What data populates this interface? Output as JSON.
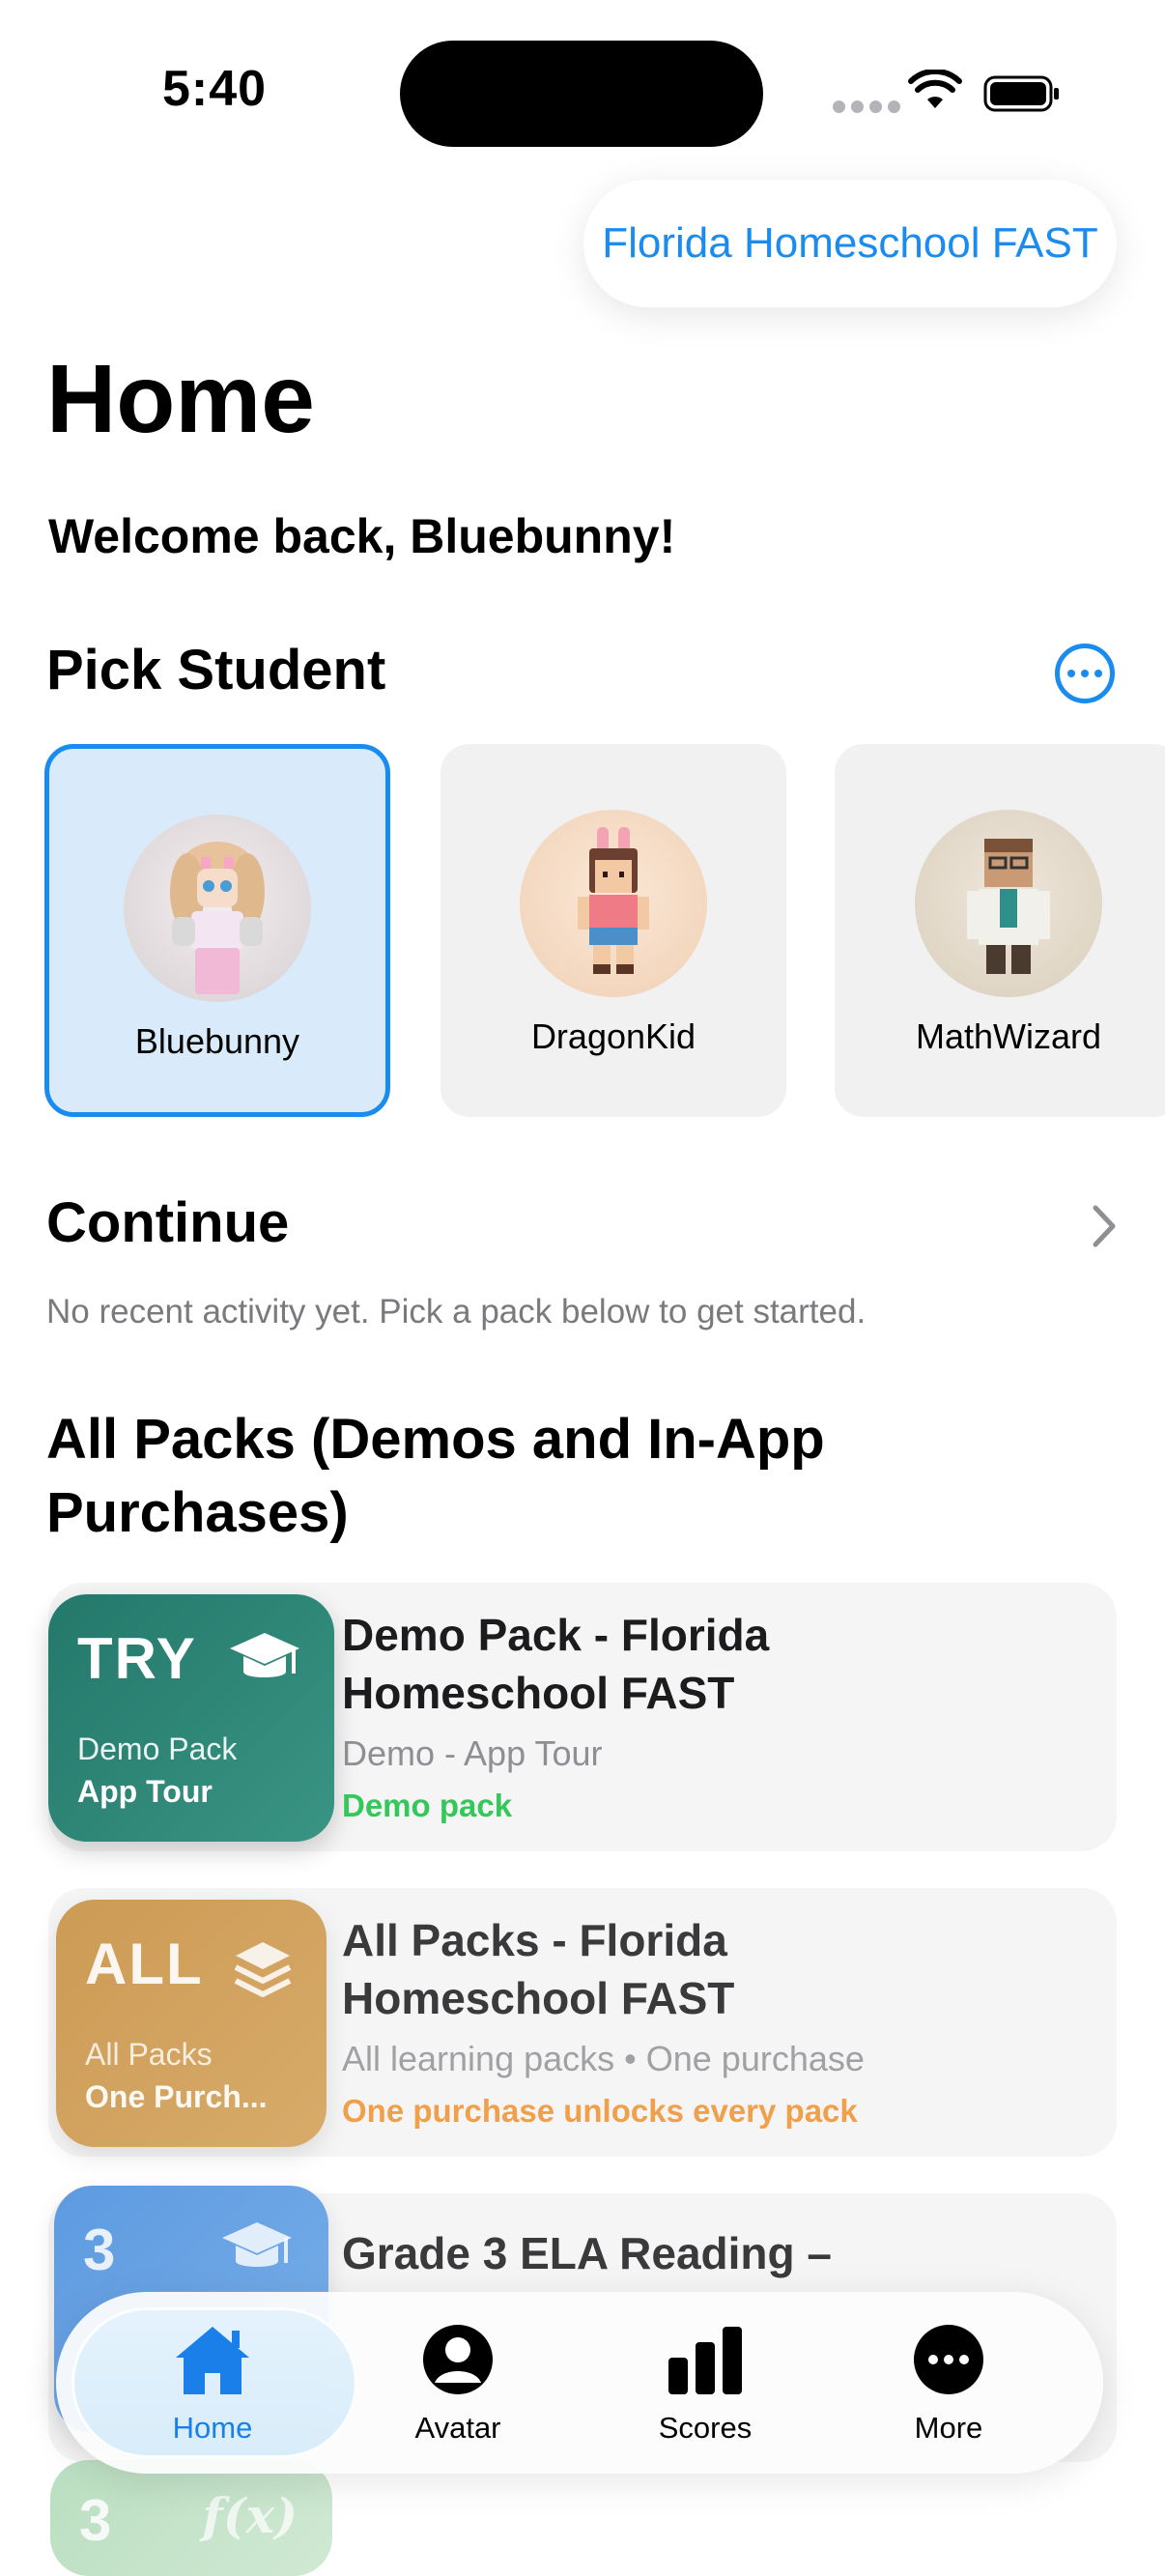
{
  "status_bar": {
    "time": "5:40"
  },
  "header": {
    "context_pill": "Florida Homeschool FAST"
  },
  "page": {
    "title": "Home",
    "welcome": "Welcome back, Bluebunny!"
  },
  "pick_student": {
    "title": "Pick Student",
    "more_icon": "ellipsis-circle-icon",
    "students": [
      {
        "name": "Bluebunny",
        "selected": true
      },
      {
        "name": "DragonKid",
        "selected": false
      },
      {
        "name": "MathWizard",
        "selected": false
      }
    ]
  },
  "continue_section": {
    "title": "Continue",
    "empty_hint": "No recent activity yet. Pick a pack below to get started."
  },
  "packs_section": {
    "title": "All Packs (Demos and In-App Purchases)",
    "packs": [
      {
        "tile_big": "TRY",
        "tile_line1": "Demo Pack",
        "tile_line2": "App Tour",
        "tile_icon": "graduation-cap-icon",
        "title": "Demo Pack - Florida Homeschool FAST",
        "subtitle": "Demo - App Tour",
        "tag": "Demo pack",
        "tag_color": "#34c759",
        "tile_color": "#2b8a76"
      },
      {
        "tile_big": "ALL",
        "tile_line1": "All Packs",
        "tile_line2": "One Purch...",
        "tile_icon": "stack-layers-icon",
        "title": "All Packs - Florida Homeschool FAST",
        "subtitle": "All learning packs • One purchase",
        "tag": "One purchase unlocks every pack",
        "tag_color": "#f0a04b",
        "tile_color": "#d4a45e"
      },
      {
        "tile_big": "3",
        "tile_icon": "graduation-cap-icon",
        "title": "Grade 3 ELA Reading –",
        "tile_color": "#6aa6e6"
      },
      {
        "tile_big": "3",
        "tile_icon": "function-icon",
        "tile_color": "#9fd0a8"
      }
    ]
  },
  "tab_bar": {
    "tabs": [
      {
        "label": "Home",
        "icon": "house-icon",
        "active": true
      },
      {
        "label": "Avatar",
        "icon": "person-circle-icon",
        "active": false
      },
      {
        "label": "Scores",
        "icon": "bar-chart-icon",
        "active": false
      },
      {
        "label": "More",
        "icon": "ellipsis-circle-icon",
        "active": false
      }
    ]
  },
  "colors": {
    "accent": "#1a8cf0",
    "selected_card_bg": "#d9ebfb",
    "card_bg": "#f1f1f1"
  }
}
